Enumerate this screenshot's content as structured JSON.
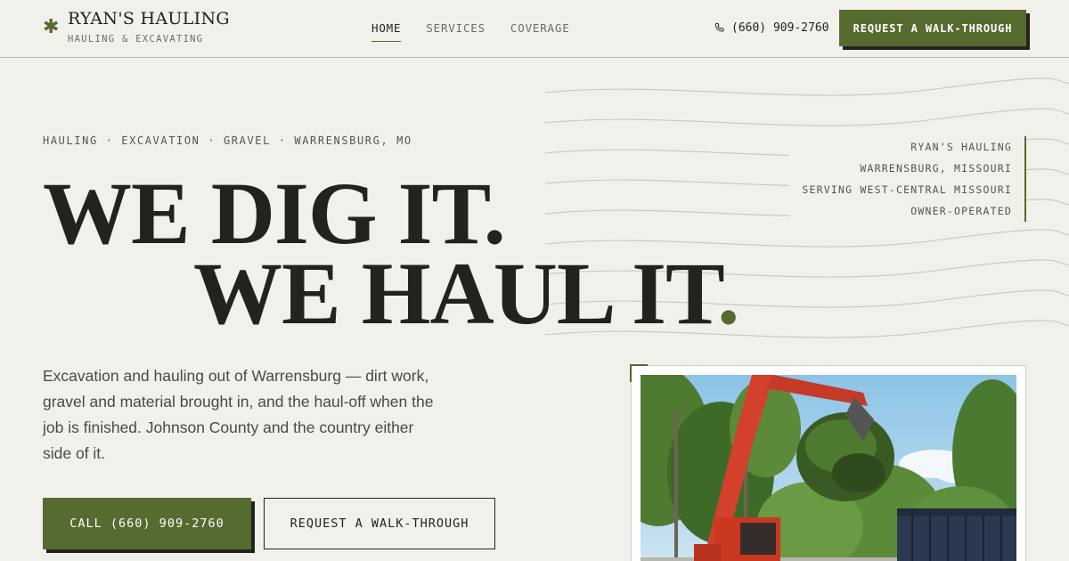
{
  "brand": {
    "mark_icon": "asterisk-icon",
    "name": "RYAN'S HAULING",
    "tagline": "HAULING & EXCAVATING"
  },
  "nav": {
    "items": [
      {
        "label": "HOME",
        "active": true
      },
      {
        "label": "SERVICES",
        "active": false
      },
      {
        "label": "COVERAGE",
        "active": false
      }
    ]
  },
  "header": {
    "phone_icon": "phone-icon",
    "phone": "(660) 909-2760",
    "cta_label": "REQUEST A WALK-THROUGH"
  },
  "hero": {
    "kicker": "HAULING · EXCAVATION · GRAVEL · WARRENSBURG, MO",
    "headline_line1": "WE DIG IT.",
    "headline_line2": "WE HAUL IT",
    "headline_line2_dot": ".",
    "info_lines": [
      "RYAN'S HAULING",
      "WARRENSBURG, MISSOURI",
      "SERVING WEST-CENTRAL MISSOURI",
      "OWNER-OPERATED"
    ],
    "lede": "Excavation and hauling out of Warrensburg — dirt work, gravel and material brought in, and the haul-off when the job is finished. Johnson County and the country either side of it.",
    "primary_button": "CALL (660) 909-2760",
    "secondary_button": "REQUEST A WALK-THROUGH"
  },
  "colors": {
    "accent": "#556b2f",
    "ink": "#22231f",
    "background": "#f2f0eb"
  }
}
